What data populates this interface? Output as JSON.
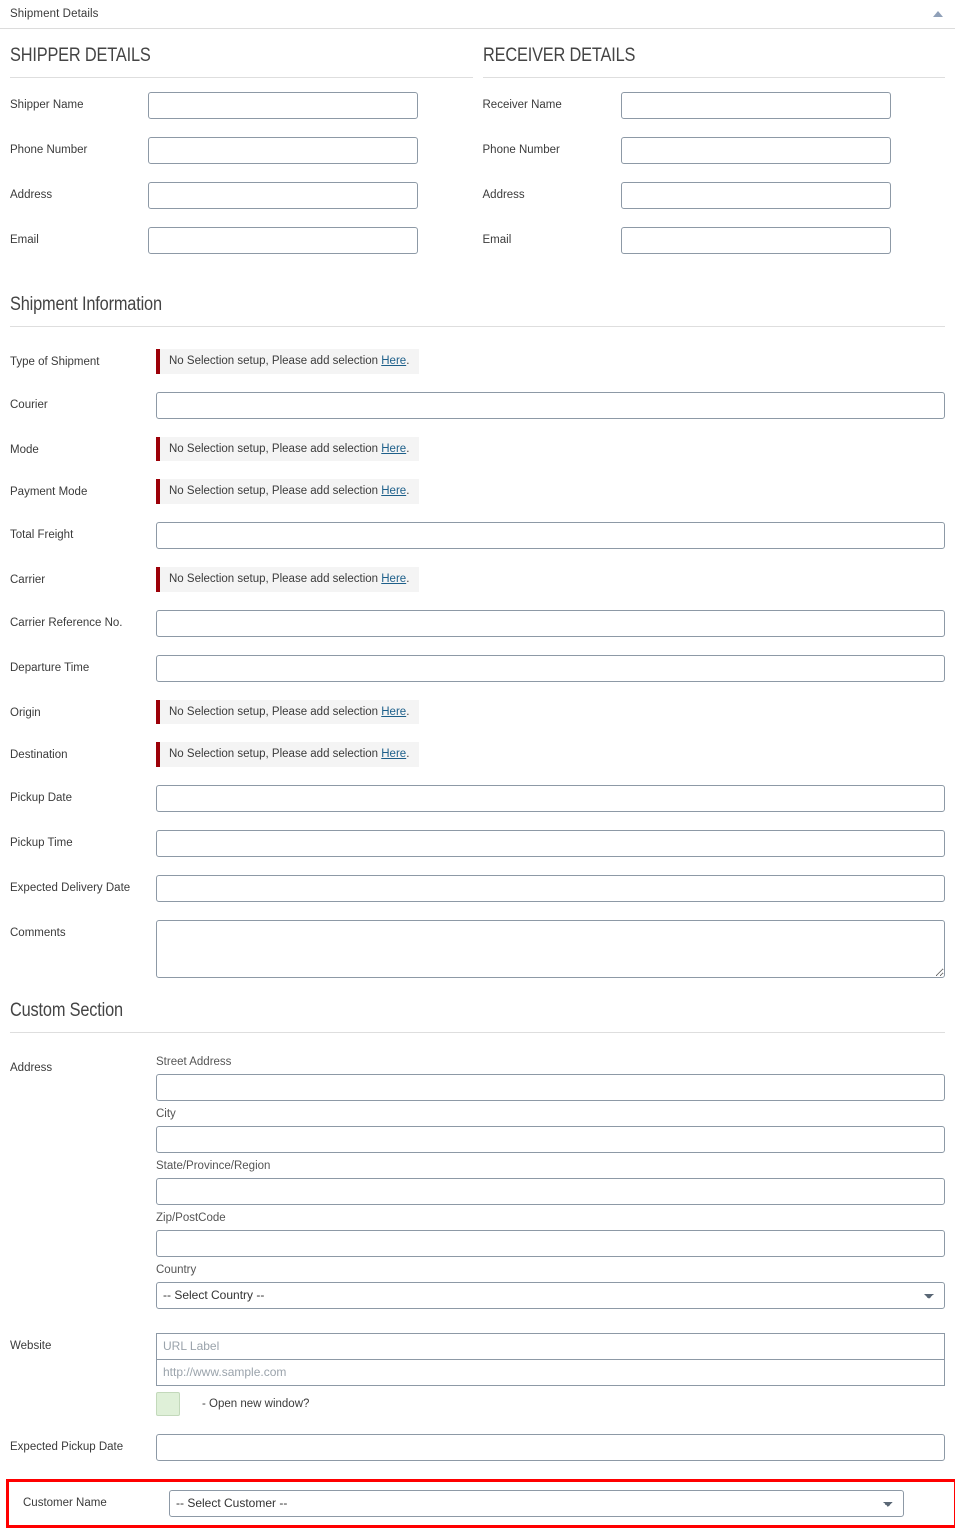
{
  "panel": {
    "title": "Shipment Details",
    "collapse_icon": "caret-up-icon"
  },
  "shipper": {
    "heading": "SHIPPER DETAILS",
    "fields": [
      {
        "label": "Shipper Name",
        "value": "",
        "placeholder": ""
      },
      {
        "label": "Phone Number",
        "value": "",
        "placeholder": ""
      },
      {
        "label": "Address",
        "value": "",
        "placeholder": ""
      },
      {
        "label": "Email",
        "value": "",
        "placeholder": ""
      }
    ]
  },
  "receiver": {
    "heading": "RECEIVER DETAILS",
    "fields": [
      {
        "label": "Receiver Name",
        "value": "",
        "placeholder": ""
      },
      {
        "label": "Phone Number",
        "value": "",
        "placeholder": ""
      },
      {
        "label": "Address",
        "value": "",
        "placeholder": ""
      },
      {
        "label": "Email",
        "value": "",
        "placeholder": ""
      }
    ]
  },
  "shipment_information": {
    "heading": "Shipment Information",
    "alert_text_prefix": "No Selection setup, Please add selection ",
    "alert_link": "Here",
    "alert_text_suffix": ".",
    "fields": [
      {
        "label": "Type of Shipment",
        "type": "alert"
      },
      {
        "label": "Courier",
        "type": "input",
        "value": ""
      },
      {
        "label": "Mode",
        "type": "alert"
      },
      {
        "label": "Payment Mode",
        "type": "alert"
      },
      {
        "label": "Total Freight",
        "type": "input",
        "value": ""
      },
      {
        "label": "Carrier",
        "type": "alert"
      },
      {
        "label": "Carrier Reference No.",
        "type": "input",
        "value": ""
      },
      {
        "label": "Departure Time",
        "type": "input",
        "value": ""
      },
      {
        "label": "Origin",
        "type": "alert"
      },
      {
        "label": "Destination",
        "type": "alert"
      },
      {
        "label": "Pickup Date",
        "type": "input",
        "value": ""
      },
      {
        "label": "Pickup Time",
        "type": "input",
        "value": ""
      },
      {
        "label": "Expected Delivery Date",
        "type": "input",
        "value": ""
      },
      {
        "label": "Comments",
        "type": "textarea",
        "value": ""
      }
    ]
  },
  "custom_section": {
    "heading": "Custom Section",
    "address": {
      "label": "Address",
      "street": {
        "label": "Street Address",
        "value": ""
      },
      "city": {
        "label": "City",
        "value": ""
      },
      "state": {
        "label": "State/Province/Region",
        "value": ""
      },
      "zip": {
        "label": "Zip/PostCode",
        "value": ""
      },
      "country": {
        "label": "Country",
        "selected": "-- Select Country --"
      }
    },
    "website": {
      "label": "Website",
      "url_label_placeholder": "URL Label",
      "url_placeholder": "http://www.sample.com",
      "url_label_value": "",
      "url_value": "",
      "open_new_window_text": "- Open new window?",
      "open_new_window_checked": false,
      "checkbox_color": "#dff0d8"
    },
    "expected_pickup_date": {
      "label": "Expected Pickup Date",
      "value": ""
    },
    "customer_name": {
      "label": "Customer Name",
      "selected": "-- Select Customer --",
      "highlight_color": "#ff0000"
    }
  },
  "colors": {
    "alert_bar": "#9c0008",
    "alert_bg": "#f4f4f4",
    "link": "#1d5f8a",
    "input_border": "#8d99a6",
    "highlight": "#ff0000"
  }
}
